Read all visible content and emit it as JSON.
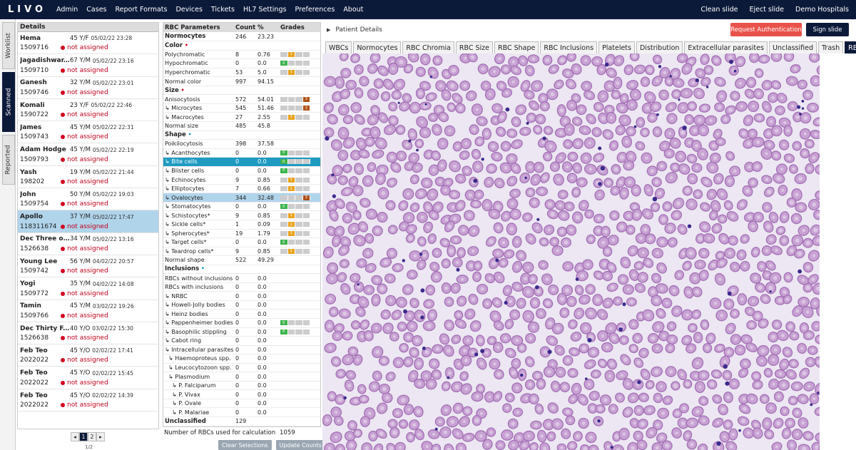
{
  "app": {
    "logo": "LIVO",
    "nav": [
      "Admin",
      "Cases",
      "Report Formats",
      "Devices",
      "Tickets",
      "HL7 Settings",
      "Preferences",
      "About"
    ],
    "right_nav": [
      "Clean slide",
      "Eject slide",
      "Demo Hospitals"
    ]
  },
  "sidetabs": [
    "Worklist",
    "Scanned",
    "Reported"
  ],
  "patients_panel": {
    "header": "Details",
    "items": [
      {
        "name": "Hema",
        "age": "45 Y/F",
        "date": "05/02/22 23:28",
        "id": "1509716",
        "status": "not assigned"
      },
      {
        "name": "Jagadishwar...",
        "age": "67 Y/M",
        "date": "05/02/22 23:16",
        "id": "1509710",
        "status": "not assigned"
      },
      {
        "name": "Ganesh",
        "age": "32 Y/M",
        "date": "05/02/22 23:01",
        "id": "1509746",
        "status": "not assigned"
      },
      {
        "name": "Komali",
        "age": "23 Y/F",
        "date": "05/02/22 22:46",
        "id": "1590722",
        "status": "not assigned"
      },
      {
        "name": "James",
        "age": "45 Y/M",
        "date": "05/02/22 22:31",
        "id": "1509743",
        "status": "not assigned"
      },
      {
        "name": "Adam Hodge",
        "age": "45 Y/M",
        "date": "05/02/22 22:19",
        "id": "1509793",
        "status": "not assigned"
      },
      {
        "name": "Yash",
        "age": "19 Y/M",
        "date": "05/02/22 21:44",
        "id": "198202",
        "status": "not assigned"
      },
      {
        "name": "John",
        "age": "50 Y/M",
        "date": "05/02/22 19:03",
        "id": "1509754",
        "status": "not assigned"
      },
      {
        "name": "Apollo",
        "age": "37 Y/M",
        "date": "05/02/22 17:47",
        "id": "118311674",
        "status": "not assigned"
      },
      {
        "name": "Dec Three o...",
        "age": "34 Y/M",
        "date": "05/02/22 13:16",
        "id": "1526638",
        "status": "not assigned"
      },
      {
        "name": "Young Lee",
        "age": "56 Y/M",
        "date": "04/02/22 20:57",
        "id": "1509742",
        "status": "not assigned"
      },
      {
        "name": "Yogi",
        "age": "35 Y/M",
        "date": "04/02/22 14:08",
        "id": "1509772",
        "status": "not assigned"
      },
      {
        "name": "Tamin",
        "age": "45 Y/M",
        "date": "03/02/22 19:26",
        "id": "1509766",
        "status": "not assigned"
      },
      {
        "name": "Dec Thirty F...",
        "age": "40 Y/O",
        "date": "03/02/22 15:30",
        "id": "1526638",
        "status": "not assigned"
      },
      {
        "name": "Feb Teo",
        "age": "45 Y/O",
        "date": "02/02/22 17:41",
        "id": "2022022",
        "status": "not assigned"
      },
      {
        "name": "Feb Teo",
        "age": "45 Y/O",
        "date": "02/02/22 15:45",
        "id": "2022022",
        "status": "not assigned"
      },
      {
        "name": "Feb Teo",
        "age": "45 Y/O",
        "date": "02/02/22 14:39",
        "id": "2022022",
        "status": "not assigned"
      }
    ],
    "selected_index": 8,
    "pager": {
      "prev": "◂",
      "pages": [
        "1",
        "2"
      ],
      "next": "▸",
      "current": "1",
      "note": "1/2"
    }
  },
  "rbc_table": {
    "headers": [
      "RBC Parameters",
      "Count",
      "%",
      "Grades"
    ],
    "rows": [
      {
        "name": "Normocytes",
        "count": "246",
        "pct": "23.23",
        "sec": true
      },
      {
        "name": "Color",
        "count": "",
        "pct": "",
        "sec": true,
        "dot": "red"
      },
      {
        "name": "Polychromatic",
        "count": "8",
        "pct": "0.76",
        "grade": 1
      },
      {
        "name": "Hypochromatic",
        "count": "0",
        "pct": "0.0",
        "grade": 0
      },
      {
        "name": "Hyperchromatic",
        "count": "53",
        "pct": "5.0",
        "grade": 1
      },
      {
        "name": "Normal color",
        "count": "997",
        "pct": "94.15"
      },
      {
        "name": "Size",
        "count": "",
        "pct": "",
        "sec": true,
        "dot": "red"
      },
      {
        "name": "Anisocytosis",
        "count": "572",
        "pct": "54.01",
        "grade": 3
      },
      {
        "name": "↳ Microcytes",
        "count": "545",
        "pct": "51.46",
        "grade": 3
      },
      {
        "name": "↳ Macrocytes",
        "count": "27",
        "pct": "2.55",
        "grade": 1
      },
      {
        "name": "Normal size",
        "count": "485",
        "pct": "45.8"
      },
      {
        "name": "Shape",
        "count": "",
        "pct": "",
        "sec": true,
        "dot": "blue"
      },
      {
        "name": "Poikilocytosis",
        "count": "398",
        "pct": "37.58"
      },
      {
        "name": "↳ Acanthocytes",
        "count": "0",
        "pct": "0.0",
        "grade": 0
      },
      {
        "name": "↳ Bite cells",
        "count": "0",
        "pct": "0.0",
        "grade": 0,
        "hl": "dark"
      },
      {
        "name": "↳ Blister cells",
        "count": "0",
        "pct": "0.0",
        "grade": 0
      },
      {
        "name": "↳ Echinocytes",
        "count": "9",
        "pct": "0.85",
        "grade": 1
      },
      {
        "name": "↳ Elliptocytes",
        "count": "7",
        "pct": "0.66",
        "grade": 1
      },
      {
        "name": "↳ Ovalocytes",
        "count": "344",
        "pct": "32.48",
        "grade": 3,
        "hl": "light"
      },
      {
        "name": "↳ Stomatocytes",
        "count": "0",
        "pct": "0.0",
        "grade": 0
      },
      {
        "name": "↳ Schistocytes*",
        "count": "9",
        "pct": "0.85",
        "grade": 1
      },
      {
        "name": "↳ Sickle cells*",
        "count": "1",
        "pct": "0.09",
        "grade": 1
      },
      {
        "name": "↳ Spherocytes*",
        "count": "19",
        "pct": "1.79",
        "grade": 1
      },
      {
        "name": "↳ Target cells*",
        "count": "0",
        "pct": "0.0",
        "grade": 0
      },
      {
        "name": "↳ Teardrop cells*",
        "count": "9",
        "pct": "0.85",
        "grade": 1
      },
      {
        "name": "Normal shape",
        "count": "522",
        "pct": "49.29"
      },
      {
        "name": "Inclusions",
        "count": "",
        "pct": "",
        "sec": true,
        "dot": "blue"
      },
      {
        "name": "RBCs without inclusions",
        "count": "0",
        "pct": "0.0"
      },
      {
        "name": "RBCs with inclusions",
        "count": "0",
        "pct": "0.0"
      },
      {
        "name": "↳ NRBC",
        "count": "0",
        "pct": "0.0"
      },
      {
        "name": "↳ Howell-Jolly bodies",
        "count": "0",
        "pct": "0.0"
      },
      {
        "name": "↳ Heinz bodies",
        "count": "0",
        "pct": "0.0"
      },
      {
        "name": "↳ Pappenheimer bodies",
        "count": "0",
        "pct": "0.0",
        "grade": 0
      },
      {
        "name": "↳ Basophilic stippling",
        "count": "0",
        "pct": "0.0",
        "grade": 0
      },
      {
        "name": "↳ Cabot ring",
        "count": "0",
        "pct": "0.0"
      },
      {
        "name": "↳ Intracellular parasites",
        "count": "0",
        "pct": "0.0"
      },
      {
        "name": "  ↳ Haemoproteus spp.",
        "count": "0",
        "pct": "0.0"
      },
      {
        "name": "  ↳ Leucocytozoon spp.",
        "count": "0",
        "pct": "0.0"
      },
      {
        "name": "  ↳ Plasmodium",
        "count": "0",
        "pct": "0.0"
      },
      {
        "name": "    ↳ P. Falciparum",
        "count": "0",
        "pct": "0.0"
      },
      {
        "name": "    ↳ P. Vivax",
        "count": "0",
        "pct": "0.0"
      },
      {
        "name": "    ↳ P. Ovale",
        "count": "0",
        "pct": "0.0"
      },
      {
        "name": "    ↳ P. Malariae",
        "count": "0",
        "pct": "0.0"
      },
      {
        "name": "Unclassified",
        "count": "129",
        "pct": "",
        "sec": true
      }
    ],
    "calc_label": "Number of RBCs used for calculation",
    "calc_value": "1059",
    "clear_btn": "Clear Selections",
    "update_btn": "Update Counts"
  },
  "viewer": {
    "title": "Patient Details",
    "request_btn": "Request Authentication",
    "sign_btn": "Sign slide",
    "tabs": [
      "WBCs",
      "Normocytes",
      "RBC Chromia",
      "RBC Size",
      "RBC Shape",
      "RBC Inclusions",
      "Platelets",
      "Distribution",
      "Extracellular parasites",
      "Unclassified",
      "Trash",
      "RBC View"
    ],
    "active_tab": "RBC View"
  },
  "colors": {
    "navy": "#0c1a3a",
    "red": "#d0021b",
    "selected_row": "#1f9bc2",
    "selected_patient": "#b0d4ea",
    "request": "#e8524a"
  }
}
